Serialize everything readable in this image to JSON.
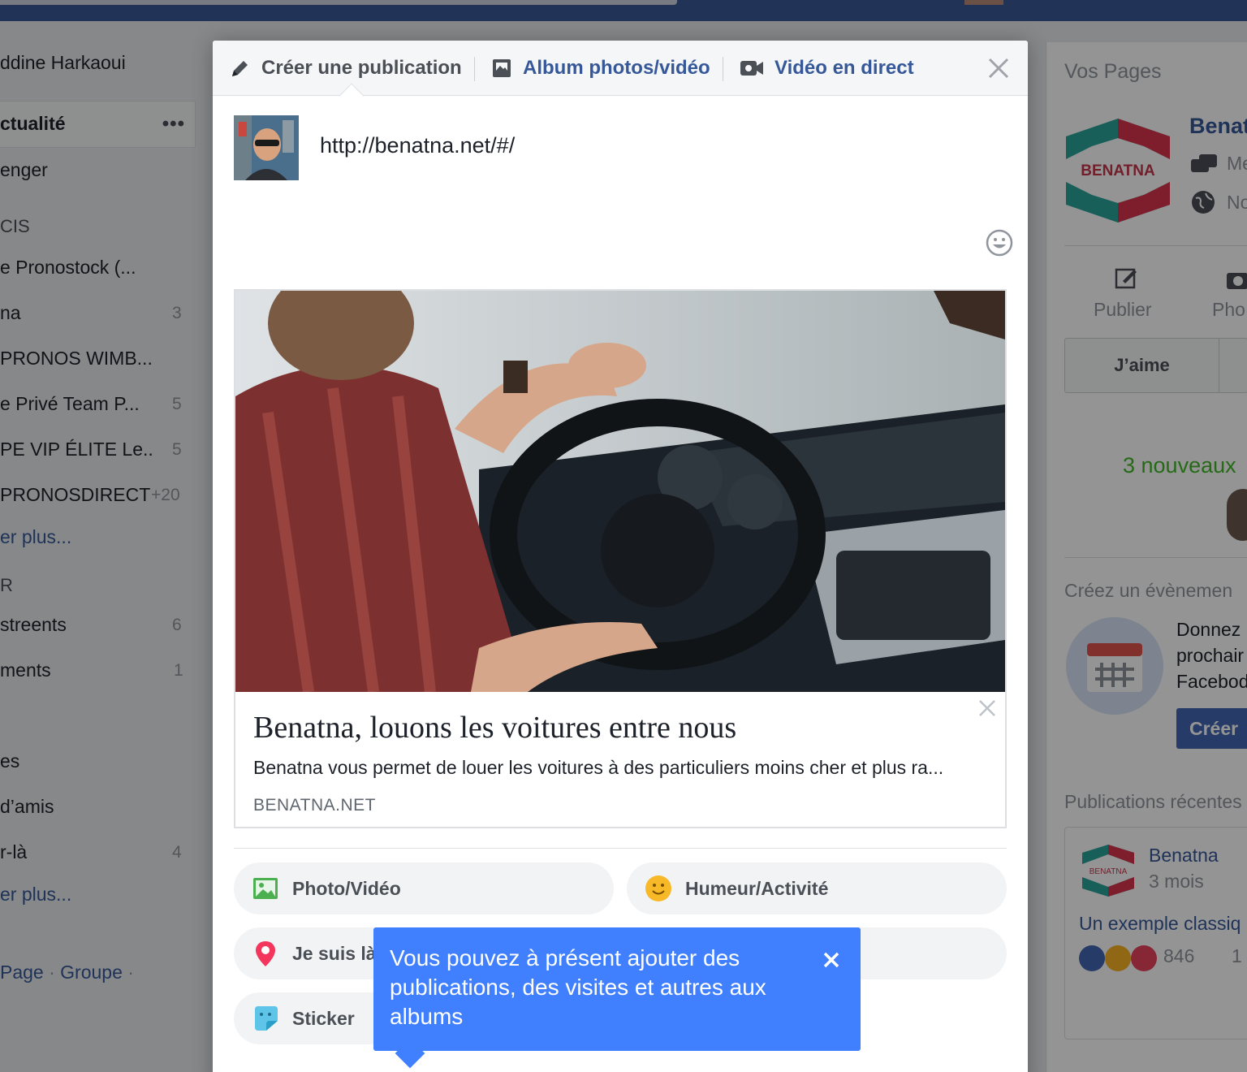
{
  "colors": {
    "brand_blue": "#3b5998",
    "link_blue": "#365899",
    "tooltip_blue": "#4080ff",
    "green_text": "#42b72a"
  },
  "left_sidebar": {
    "user_name": "ddine Harkaoui",
    "news_feed": "ctualité",
    "items": [
      {
        "label": "enger",
        "count": ""
      },
      {
        "label": "CIS",
        "count": ""
      },
      {
        "label": "e Pronostock (...",
        "count": ""
      },
      {
        "label": "na",
        "count": "3"
      },
      {
        "label": "PRONOS WIMB...",
        "count": ""
      },
      {
        "label": "e Privé Team P...",
        "count": "5"
      },
      {
        "label": "PE VIP ÉLITE Le..",
        "count": "5"
      },
      {
        "label": "PRONOSDIRECT",
        "count": "+20"
      },
      {
        "label": "er plus...",
        "count": ""
      },
      {
        "label": "R",
        "count": ""
      },
      {
        "label": "streents",
        "count": "6"
      },
      {
        "label": "ments",
        "count": "1"
      },
      {
        "label": "es",
        "count": ""
      },
      {
        "label": "d’amis",
        "count": ""
      },
      {
        "label": "r-là",
        "count": "4"
      },
      {
        "label": "er plus...",
        "count": ""
      }
    ],
    "footer_page": "Page",
    "footer_group": "Groupe",
    "footer_dot": "·"
  },
  "right_sidebar": {
    "your_pages": "Vos Pages",
    "page_name": "Benat",
    "logo_text": "BENATNA",
    "messages_short": "Me",
    "notifs_short": "No",
    "publish": "Publier",
    "photo_short": "Pho",
    "like": "J’aime",
    "new_count": "3 nouveaux",
    "create_event": "Créez un évènemen",
    "event_text_1": "Donnez",
    "event_text_2": "prochair",
    "event_text_3": "Facebod",
    "create_button": "Créer",
    "recent_posts": "Publications récentes",
    "recent_author": "Benatna",
    "recent_time": "3 mois",
    "recent_text": "Un exemple classiq",
    "reactions_count": "846",
    "comments_short": "1"
  },
  "composer": {
    "tabs": {
      "create": "Créer une publication",
      "album": "Album photos/vidéo",
      "live": "Vidéo en direct"
    },
    "post_text": "http://benatna.net/#/",
    "link_preview": {
      "title": "Benatna, louons les voitures entre nous",
      "description": "Benatna vous permet de louer les voitures à des particuliers moins cher et plus ra...",
      "domain": "BENATNA.NET"
    },
    "actions": {
      "photo": "Photo/Vidéo",
      "mood": "Humeur/Activité",
      "checkin": "Je suis là",
      "sticker": "Sticker"
    },
    "tooltip": "Vous pouvez à présent ajouter des publications, des visites et autres aux albums"
  },
  "icons": [
    "pencil-icon",
    "album-icon",
    "video-camera-icon",
    "close-icon",
    "emoji-icon",
    "photo-icon",
    "smiley-icon",
    "location-pin-icon",
    "sticker-icon",
    "calendar-icon",
    "speech-bubbles-icon",
    "globe-icon",
    "camera-icon",
    "edit-icon"
  ]
}
